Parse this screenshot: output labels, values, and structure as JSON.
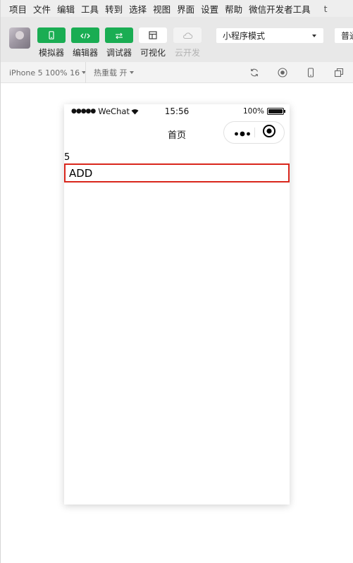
{
  "menu": {
    "items": [
      "项目",
      "文件",
      "编辑",
      "工具",
      "转到",
      "选择",
      "视图",
      "界面",
      "设置",
      "帮助",
      "微信开发者工具"
    ],
    "extra": "t"
  },
  "toolbar": {
    "buttons": [
      {
        "label": "模拟器",
        "icon": "phone-icon",
        "state": "active"
      },
      {
        "label": "编辑器",
        "icon": "code-icon",
        "state": "active"
      },
      {
        "label": "调试器",
        "icon": "debug-toggle-icon",
        "state": "active"
      },
      {
        "label": "可视化",
        "icon": "layout-icon",
        "state": "normal"
      },
      {
        "label": "云开发",
        "icon": "cloud-icon",
        "state": "disabled"
      }
    ],
    "mode_select": "小程序模式",
    "compile_select": "普通"
  },
  "subbar": {
    "device": "iPhone 5 100% 16",
    "hot_reload": "热重载 开"
  },
  "simulator": {
    "status": {
      "carrier": "WeChat",
      "signal_dots": "●●●●●",
      "time": "15:56",
      "battery": "100%"
    },
    "nav_title": "首页",
    "count": "5",
    "add_label": "ADD"
  },
  "colors": {
    "accent_green": "#1aad53",
    "button_border_red": "#d9261c"
  }
}
